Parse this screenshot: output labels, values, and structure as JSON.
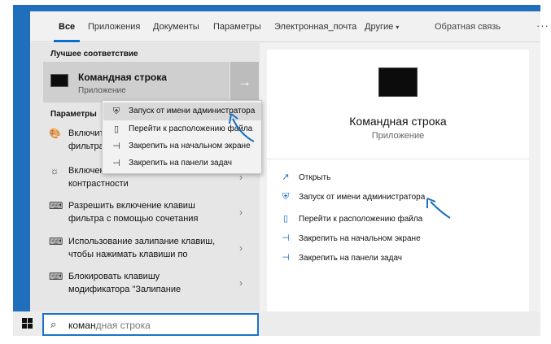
{
  "tabs": [
    {
      "label": "Все",
      "active": true
    },
    {
      "label": "Приложения"
    },
    {
      "label": "Документы"
    },
    {
      "label": "Параметры"
    },
    {
      "label": "Электронная_почта"
    },
    {
      "label": "Другие"
    }
  ],
  "feedback": "Обратная связь",
  "more_glyph": "···",
  "tab_chevron_glyph": "▾",
  "best_match": {
    "section_title": "Лучшее соответствие",
    "title": "Командная строка",
    "subtitle": "Приложение",
    "icon": "cmd-icon",
    "arrow_glyph": "→"
  },
  "settings": {
    "section_title": "Параметры",
    "items": [
      {
        "line1": "Включит",
        "line2": "фильтра",
        "icon": "palette-icon",
        "glyph": "🎨"
      },
      {
        "line1": "Включен",
        "line2": "контрастности",
        "icon": "brightness-icon",
        "glyph": "☼"
      },
      {
        "line1": "Разрешить включение клавиш",
        "line2": "фильтра с помощью сочетания",
        "icon": "keyboard-icon",
        "glyph": "⌨"
      },
      {
        "line1": "Использование залипание клавиш,",
        "line2": "чтобы нажимать клавиши по",
        "icon": "keyboard-icon",
        "glyph": "⌨"
      },
      {
        "line1": "Блокировать клавишу",
        "line2": "модификатора \"Залипание",
        "icon": "keyboard-icon",
        "glyph": "⌨"
      }
    ],
    "chevron_glyph": "›"
  },
  "context_menu": {
    "items": [
      {
        "label": "Запуск от имени администратора",
        "icon": "shield-icon",
        "glyph": "⛨"
      },
      {
        "label": "Перейти к расположению файла",
        "icon": "file-location-icon",
        "glyph": "▯"
      },
      {
        "label": "Закрепить на начальном экране",
        "icon": "pin-icon",
        "glyph": "⊣"
      },
      {
        "label": "Закрепить на панели задач",
        "icon": "pin-icon",
        "glyph": "⊣"
      }
    ]
  },
  "preview": {
    "title": "Командная строка",
    "subtitle": "Приложение",
    "actions": [
      {
        "label": "Открыть",
        "icon": "open-icon",
        "glyph": "↗"
      },
      {
        "label": "Запуск от имени администратора",
        "icon": "shield-icon",
        "glyph": "⛨"
      },
      {
        "label": "Перейти к расположению файла",
        "icon": "file-location-icon",
        "glyph": "▯"
      },
      {
        "label": "Закрепить на начальном экране",
        "icon": "pin-icon",
        "glyph": "⊣"
      },
      {
        "label": "Закрепить на панели задач",
        "icon": "pin-icon",
        "glyph": "⊣"
      }
    ]
  },
  "search": {
    "typed": "коман",
    "hint": "дная строка",
    "glyph": "⌕"
  },
  "colors": {
    "accent": "#0a6ed1",
    "desktop": "#1f6fbd",
    "annotation_arrow": "#1a6fbf"
  }
}
